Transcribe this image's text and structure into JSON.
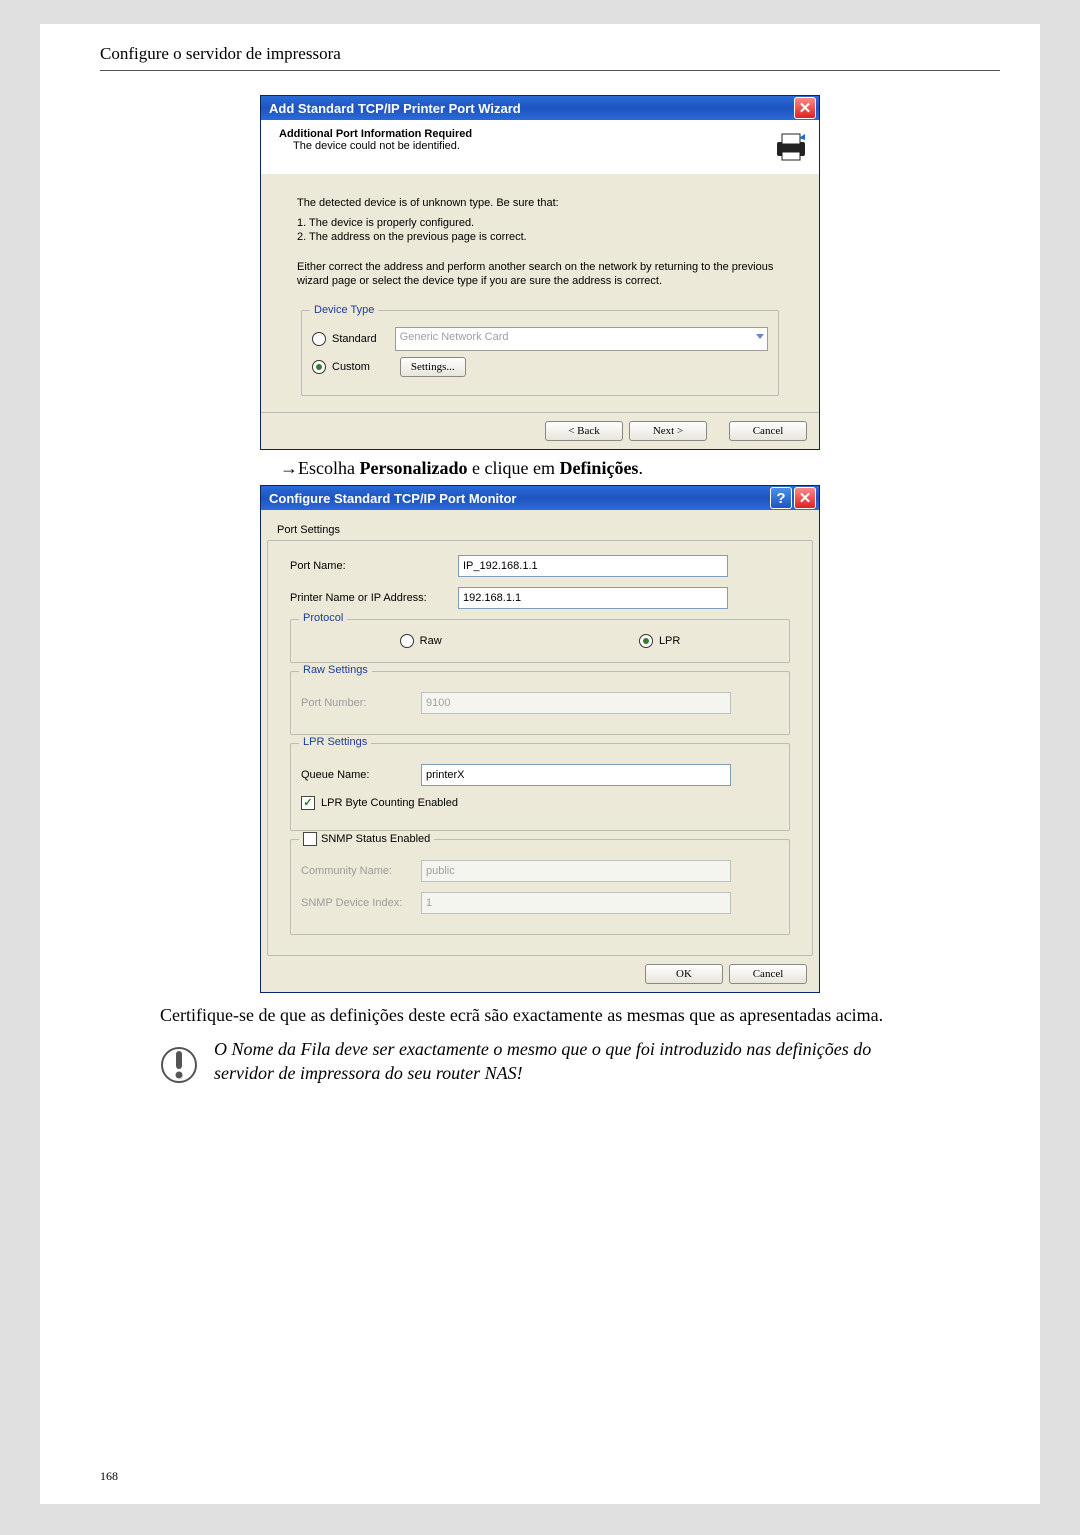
{
  "page": {
    "header": "Configure o servidor de impressora",
    "number": "168"
  },
  "wizard1": {
    "title": "Add Standard TCP/IP Printer Port Wizard",
    "head_title": "Additional Port Information Required",
    "head_sub": "The device could not be identified.",
    "para1": "The detected device is of unknown type.  Be sure that:",
    "item1": "1.  The device is properly configured.",
    "item2": "2.  The address on the previous page is correct.",
    "para2": "Either correct the address and perform another search on the network by returning to the previous wizard page or select the device type if you are sure the address is correct.",
    "device_type_legend": "Device Type",
    "radio_standard": "Standard",
    "select_value": "Generic Network Card",
    "radio_custom": "Custom",
    "settings_btn": "Settings...",
    "back": "< Back",
    "next": "Next >",
    "cancel": "Cancel"
  },
  "instruction": {
    "arrow": "→",
    "pre": "Escolha ",
    "b1": "Personalizado",
    "mid": " e clique em ",
    "b2": "Definições",
    "end": "."
  },
  "wizard2": {
    "title": "Configure Standard TCP/IP Port Monitor",
    "tab": "Port Settings",
    "port_name_lbl": "Port Name:",
    "port_name_val": "IP_192.168.1.1",
    "printer_lbl": "Printer Name or IP Address:",
    "printer_val": "192.168.1.1",
    "protocol_legend": "Protocol",
    "proto_raw": "Raw",
    "proto_lpr": "LPR",
    "raw_legend": "Raw Settings",
    "port_num_lbl": "Port Number:",
    "port_num_val": "9100",
    "lpr_legend": "LPR Settings",
    "queue_lbl": "Queue Name:",
    "queue_val": "printerX",
    "lpr_byte": "LPR Byte Counting Enabled",
    "snmp_legend": "SNMP Status Enabled",
    "community_lbl": "Community Name:",
    "community_val": "public",
    "snmp_idx_lbl": "SNMP Device Index:",
    "snmp_idx_val": "1",
    "ok": "OK",
    "cancel": "Cancel"
  },
  "body_text": "Certifique-se de que as definições deste ecrã são exactamente as mesmas que as apresentadas acima.",
  "note_text": "O Nome da Fila deve ser exactamente o mesmo que o que foi introduzido nas definições do servidor de impressora do seu router NAS!"
}
